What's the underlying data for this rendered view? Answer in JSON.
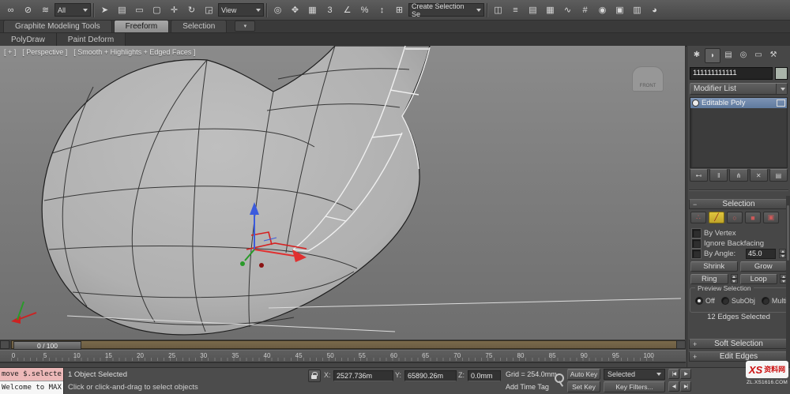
{
  "colors": {
    "accent_selection": "#d42222",
    "gizmo_x": "#e03030",
    "gizmo_y": "#2a9a2a",
    "gizmo_z": "#3b5bdd",
    "active_tab": "#9a9a9a"
  },
  "toolbar": {
    "groupA": [
      {
        "name": "select-and-link-icon",
        "glyph": "∞"
      },
      {
        "name": "unlink-selection-icon",
        "glyph": "⊘"
      },
      {
        "name": "bind-to-space-warp-icon",
        "glyph": "≋"
      }
    ],
    "filter_dropdown": {
      "value": "All"
    },
    "groupB": [
      {
        "name": "select-object-icon",
        "glyph": "➤"
      },
      {
        "name": "select-by-name-icon",
        "glyph": "▤"
      },
      {
        "name": "rectangular-selection-region-icon",
        "glyph": "▭"
      },
      {
        "name": "window-crossing-icon",
        "glyph": "▢"
      },
      {
        "name": "select-and-move-icon",
        "glyph": "✛"
      },
      {
        "name": "select-and-rotate-icon",
        "glyph": "↻"
      },
      {
        "name": "select-and-scale-icon",
        "glyph": "◲"
      }
    ],
    "view_dropdown": {
      "value": "View"
    },
    "groupC": [
      {
        "name": "use-pivot-center-icon",
        "glyph": "◎"
      },
      {
        "name": "select-and-manipulate-icon",
        "glyph": "✥"
      },
      {
        "name": "keyboard-shortcut-override-icon",
        "glyph": "▦"
      },
      {
        "name": "snap-toggle-3d-icon",
        "glyph": "3"
      },
      {
        "name": "angle-snap-icon",
        "glyph": "∠"
      },
      {
        "name": "percent-snap-icon",
        "glyph": "%"
      },
      {
        "name": "spinner-snap-icon",
        "glyph": "↕"
      },
      {
        "name": "edit-named-selection-sets-icon",
        "glyph": "⊞"
      }
    ],
    "selection_set_dropdown": {
      "value": "Create Selection Se"
    },
    "groupD": [
      {
        "name": "mirror-icon",
        "glyph": "◫"
      },
      {
        "name": "align-icon",
        "glyph": "≡"
      },
      {
        "name": "layer-manager-icon",
        "glyph": "▤"
      },
      {
        "name": "graphite-ribbon-toggle-icon",
        "glyph": "▦"
      },
      {
        "name": "curve-editor-icon",
        "glyph": "∿"
      },
      {
        "name": "schematic-view-icon",
        "glyph": "#"
      },
      {
        "name": "material-editor-icon",
        "glyph": "◉"
      },
      {
        "name": "render-setup-icon",
        "glyph": "▣"
      },
      {
        "name": "rendered-frame-window-icon",
        "glyph": "▥"
      },
      {
        "name": "render-production-icon",
        "glyph": "◕"
      }
    ]
  },
  "ribbon": {
    "tab_graphite": "Graphite Modeling Tools",
    "tab_freeform": "Freeform",
    "tab_selection": "Selection",
    "minimize_glyph": "▾",
    "polydraw": "PolyDraw",
    "paint_deform": "Paint Deform"
  },
  "viewport": {
    "label_plus": "[ + ]",
    "label_view": "[ Perspective ]",
    "label_shading": "[ Smooth + Highlights + Edged Faces ]",
    "viewcube_label": "FRONT"
  },
  "command_panel": {
    "tabs": [
      {
        "name": "create-tab-icon",
        "glyph": "✱"
      },
      {
        "name": "modify-tab-icon",
        "glyph": "◗",
        "active": true
      },
      {
        "name": "hierarchy-tab-icon",
        "glyph": "▤"
      },
      {
        "name": "motion-tab-icon",
        "glyph": "◎"
      },
      {
        "name": "display-tab-icon",
        "glyph": "▭"
      },
      {
        "name": "utilities-tab-icon",
        "glyph": "⚒"
      }
    ],
    "object_name": "111111111111",
    "modifier_list": "Modifier List",
    "stack_item": "Editable Poly",
    "stack_buttons": [
      {
        "name": "pin-stack-icon",
        "glyph": "⊷"
      },
      {
        "name": "show-end-result-icon",
        "glyph": "‖"
      },
      {
        "name": "make-unique-icon",
        "glyph": "⋔"
      },
      {
        "name": "remove-modifier-icon",
        "glyph": "✕"
      },
      {
        "name": "configure-modifier-sets-icon",
        "glyph": "▤"
      }
    ],
    "selection": {
      "title": "Selection",
      "subobject_modes": [
        {
          "name": "vertex-mode-icon",
          "glyph": "∴"
        },
        {
          "name": "edge-mode-icon",
          "glyph": "╱",
          "active": true
        },
        {
          "name": "border-mode-icon",
          "glyph": "○"
        },
        {
          "name": "polygon-mode-icon",
          "glyph": "■"
        },
        {
          "name": "element-mode-icon",
          "glyph": "▣"
        }
      ],
      "by_vertex": "By Vertex",
      "ignore_backfacing": "Ignore Backfacing",
      "by_angle": "By Angle:",
      "by_angle_value": "45.0",
      "shrink": "Shrink",
      "grow": "Grow",
      "ring": "Ring",
      "loop": "Loop",
      "preview_title": "Preview Selection",
      "preview_off": "Off",
      "preview_subobj": "SubObj",
      "preview_multi": "Multi",
      "status": "12 Edges Selected"
    },
    "soft_selection": "Soft Selection",
    "edit_edges": "Edit Edges"
  },
  "timeline": {
    "slider": "0 / 100",
    "ticks": [
      "0",
      "5",
      "10",
      "15",
      "20",
      "25",
      "30",
      "35",
      "40",
      "45",
      "50",
      "55",
      "60",
      "65",
      "70",
      "75",
      "80",
      "85",
      "90",
      "95",
      "100"
    ]
  },
  "statusbar": {
    "script_line": "move $.selecte",
    "listener_line": "Welcome to MAX",
    "status": "1 Object Selected",
    "prompt": "Click or click-and-drag to select objects",
    "x_label": "X:",
    "x_value": "2527.736m",
    "y_label": "Y:",
    "y_value": "65890.26m",
    "z_label": "Z:",
    "z_value": "0.0mm",
    "grid": "Grid = 254.0mm",
    "add_time_tag": "Add Time Tag",
    "auto_key": "Auto Key",
    "set_key": "Set Key",
    "selected_dropdown": "Selected",
    "key_filters": "Key Filters...",
    "transport_row1": [
      {
        "name": "go-to-start-button",
        "glyph": "|◀"
      },
      {
        "name": "play-button",
        "glyph": "▶"
      }
    ],
    "transport_row2": [
      {
        "name": "previous-frame-button",
        "glyph": "◀|"
      },
      {
        "name": "go-to-end-button",
        "glyph": "▶|"
      }
    ]
  },
  "watermark": {
    "brand_prefix": "XS",
    "brand": "资料网",
    "url": "ZL.XS1616.COM"
  }
}
